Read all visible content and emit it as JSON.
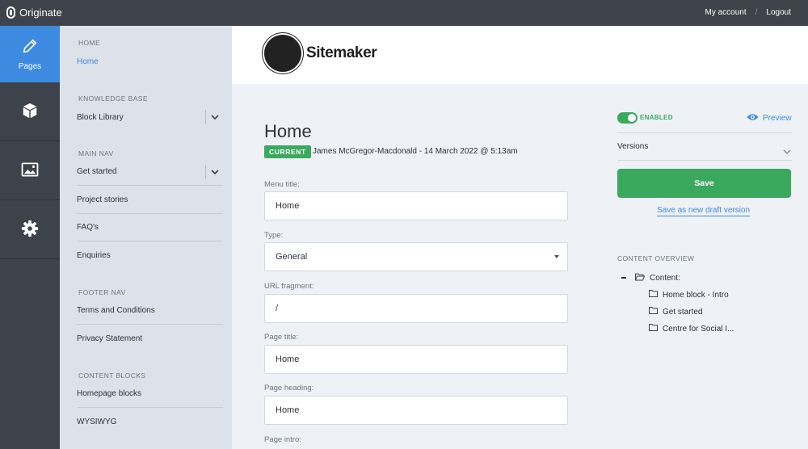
{
  "topbar": {
    "brand": "Originate",
    "my_account": "My account",
    "separator": "/",
    "logout": "Logout"
  },
  "rail": {
    "pages_label": "Pages",
    "accent": "#3d8be0"
  },
  "sidebar": {
    "home_section": "HOME",
    "home_item": "Home",
    "kb_section": "KNOWLEDGE BASE",
    "kb_item": "Block Library",
    "main_nav_section": "MAIN NAV",
    "main_nav_items": [
      "Get started",
      "Project stories",
      "FAQ's",
      "Enquiries"
    ],
    "footer_nav_section": "FOOTER NAV",
    "footer_nav_items": [
      "Terms and Conditions",
      "Privacy Statement"
    ],
    "content_blocks_section": "CONTENT BLOCKS",
    "content_blocks_items": [
      "Homepage blocks",
      "WYSIWYG"
    ]
  },
  "header": {
    "logo_text": "Sitemaker"
  },
  "page": {
    "title": "Home",
    "status_badge": "CURRENT",
    "meta": "James McGregor-Macdonald - 14 March 2022 @ 5:13am"
  },
  "form": {
    "menu_title_label": "Menu title:",
    "menu_title_value": "Home",
    "type_label": "Type:",
    "type_value": "General",
    "url_fragment_label": "URL fragment:",
    "url_fragment_value": "/",
    "page_title_label": "Page title:",
    "page_title_value": "Home",
    "page_heading_label": "Page heading:",
    "page_heading_value": "Home",
    "page_intro_label": "Page intro:"
  },
  "side_panel": {
    "enabled_label": "ENABLED",
    "preview_label": "Preview",
    "versions_label": "Versions",
    "save_label": "Save",
    "save_draft_label": "Save as new draft version",
    "overview_title": "CONTENT OVERVIEW",
    "tree_root": "Content:",
    "tree_children": [
      "Home block - Intro",
      "Get started",
      "Centre for Social I..."
    ]
  },
  "colors": {
    "success": "#3aa95e",
    "dark": "#3e434b",
    "sidebar_bg": "#dde1e9"
  }
}
